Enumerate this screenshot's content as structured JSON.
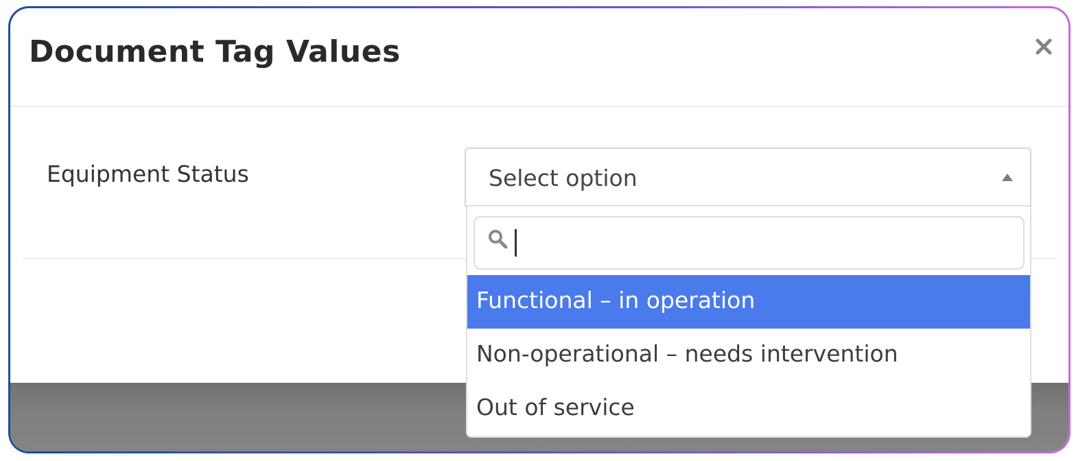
{
  "modal": {
    "title": "Document Tag Values",
    "close_symbol": "×"
  },
  "field": {
    "label": "Equipment Status"
  },
  "select": {
    "placeholder": "Select option",
    "search_value": "",
    "options": [
      {
        "label": "Functional – in operation",
        "highlighted": true
      },
      {
        "label": "Non-operational – needs intervention",
        "highlighted": false
      },
      {
        "label": "Out of service",
        "highlighted": false
      }
    ]
  },
  "icons": {
    "close": "close-icon",
    "arrow": "chevron-up-icon",
    "search": "search-icon"
  },
  "colors": {
    "highlight": "#4a7bec",
    "footer_overlay": "#808080"
  }
}
